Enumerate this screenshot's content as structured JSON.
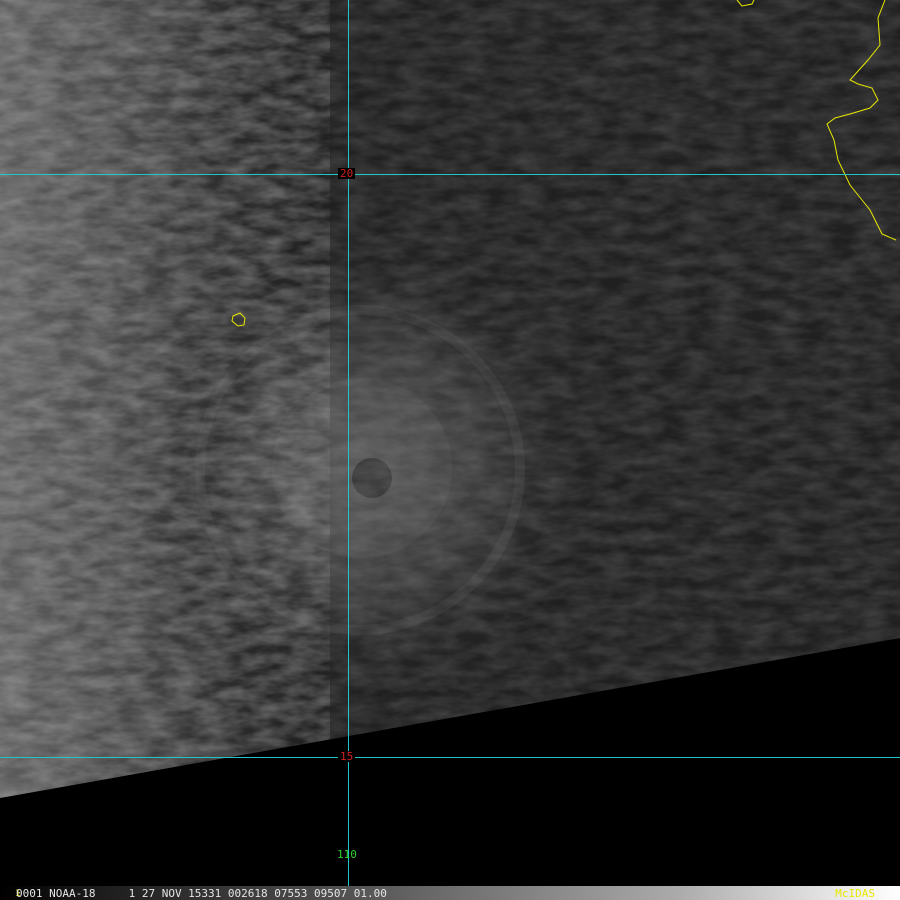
{
  "map": {
    "satellite_view": "NOAA-18 visible imagery over the eastern Pacific showing a tropical cyclone eye with a coastline outline in the upper right",
    "grid": {
      "lat_labels": [
        "20",
        "15"
      ],
      "lon_label": "110"
    },
    "colors": {
      "gridline": "#22c5c5",
      "lat_label": "#d42020",
      "lon_label": "#2ed02e",
      "coastline": "#e8e800",
      "frame_number": "#e8e800",
      "brand": "#e8e800"
    }
  },
  "statusbar": {
    "frame_number": "1",
    "text": "0001 NOAA-18     1 27 NOV 15331 002618 07553 09507 01.00",
    "brand": "McIDAS"
  }
}
